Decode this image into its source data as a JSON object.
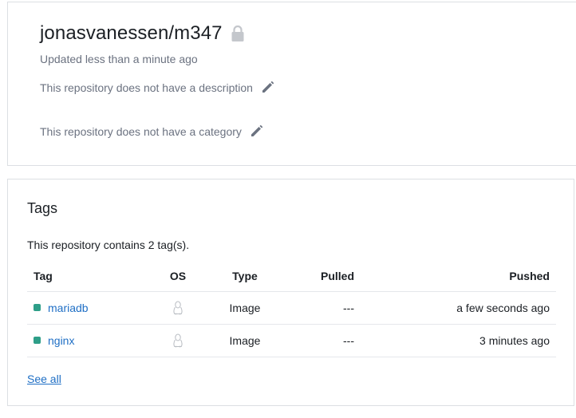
{
  "repository": {
    "name": "jonasvanessen/m347",
    "updated": "Updated less than a minute ago",
    "description": "This repository does not have a description",
    "category": "This repository does not have a category",
    "lock_icon": "lock-icon",
    "edit_icon": "pencil-icon"
  },
  "tags_section": {
    "heading": "Tags",
    "summary": "This repository contains 2 tag(s).",
    "columns": [
      "Tag",
      "OS",
      "Type",
      "Pulled",
      "Pushed"
    ],
    "rows": [
      {
        "tag": "mariadb",
        "os_icon": "linux-icon",
        "type": "Image",
        "pulled": "---",
        "pushed": "a few seconds ago"
      },
      {
        "tag": "nginx",
        "os_icon": "linux-icon",
        "type": "Image",
        "pulled": "---",
        "pushed": "3 minutes ago"
      }
    ],
    "see_all": "See all",
    "tag_color": "#2e9e88",
    "link_color": "#1f6fc5"
  }
}
